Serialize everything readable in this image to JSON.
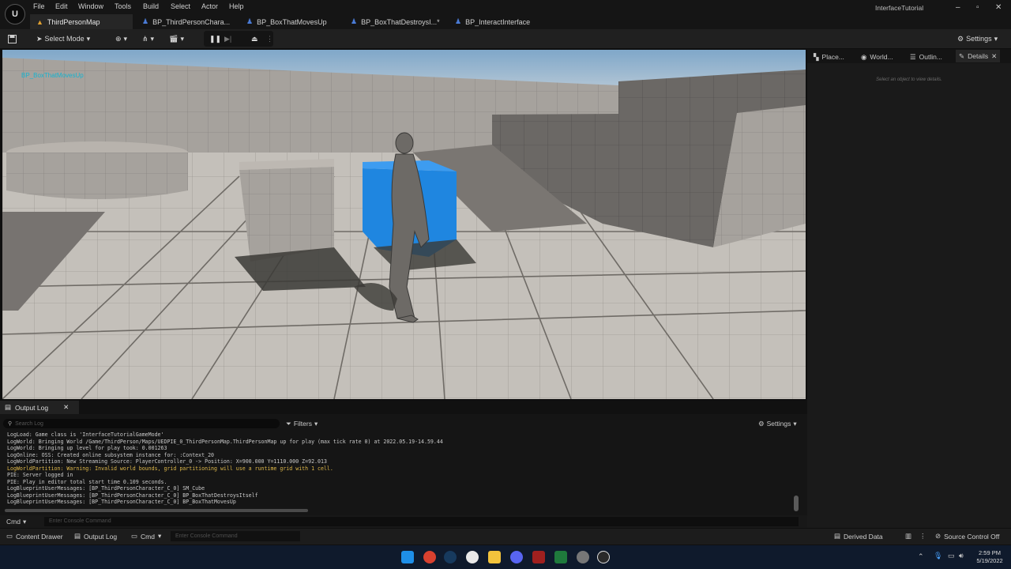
{
  "window": {
    "title": "InterfaceTutorial"
  },
  "menu": [
    "File",
    "Edit",
    "Window",
    "Tools",
    "Build",
    "Select",
    "Actor",
    "Help"
  ],
  "tabs": [
    "ThirdPersonMap",
    "BP_ThirdPersonChara...",
    "BP_BoxThatMovesUp",
    "BP_BoxThatDestroysI...*",
    "BP_InteractInterface"
  ],
  "toolbar": {
    "select_mode": "Select Mode",
    "settings": "Settings"
  },
  "viewport": {
    "selected_actor_label": "BP_BoxThatMovesUp"
  },
  "right_panel": {
    "tabs": [
      "Place...",
      "World...",
      "Outlin...",
      "Details"
    ],
    "details_hint": "Select an object to view details."
  },
  "output_log": {
    "tab": "Output Log",
    "search_placeholder": "Search Log",
    "filters": "Filters",
    "settings": "Settings",
    "lines": [
      {
        "text": "LogLoad: Game class is 'InterfaceTutorialGameMode'",
        "warn": false
      },
      {
        "text": "LogWorld: Bringing World /Game/ThirdPerson/Maps/UEDPIE_0_ThirdPersonMap.ThirdPersonMap up for play (max tick rate 0) at 2022.05.19-14.59.44",
        "warn": false
      },
      {
        "text": "LogWorld: Bringing up level for play took: 0.001263",
        "warn": false
      },
      {
        "text": "LogOnline: OSS: Created online subsystem instance for: :Context_20",
        "warn": false
      },
      {
        "text": "LogWorldPartition: New Streaming Source: PlayerController_0 -> Position: X=900.000 Y=1110.000 Z=92.013",
        "warn": false
      },
      {
        "text": "LogWorldPartition: Warning: Invalid world bounds, grid partitioning will use a runtime grid with 1 cell.",
        "warn": true
      },
      {
        "text": "PIE: Server logged in",
        "warn": false
      },
      {
        "text": "PIE: Play in editor total start time 0.109 seconds.",
        "warn": false
      },
      {
        "text": "LogBlueprintUserMessages: [BP_ThirdPersonCharacter_C_0] SM_Cube",
        "warn": false
      },
      {
        "text": "LogBlueprintUserMessages: [BP_ThirdPersonCharacter_C_0] BP_BoxThatDestroysItself",
        "warn": false
      },
      {
        "text": "LogBlueprintUserMessages: [BP_ThirdPersonCharacter_C_0] BP_BoxThatMovesUp",
        "warn": false
      }
    ],
    "cmd_label": "Cmd",
    "console_placeholder": "Enter Console Command"
  },
  "statusbar": {
    "content_drawer": "Content Drawer",
    "output_log": "Output Log",
    "cmd": "Cmd",
    "console_placeholder": "Enter Console Command",
    "derived_data": "Derived Data",
    "source_control": "Source Control Off"
  },
  "taskbar": {
    "time": "2:59 PM",
    "date": "5/19/2022"
  },
  "colors": {
    "accent_cube": "#1f86e0",
    "selection_label": "#16b3cf",
    "warning_text": "#e0b94a"
  }
}
